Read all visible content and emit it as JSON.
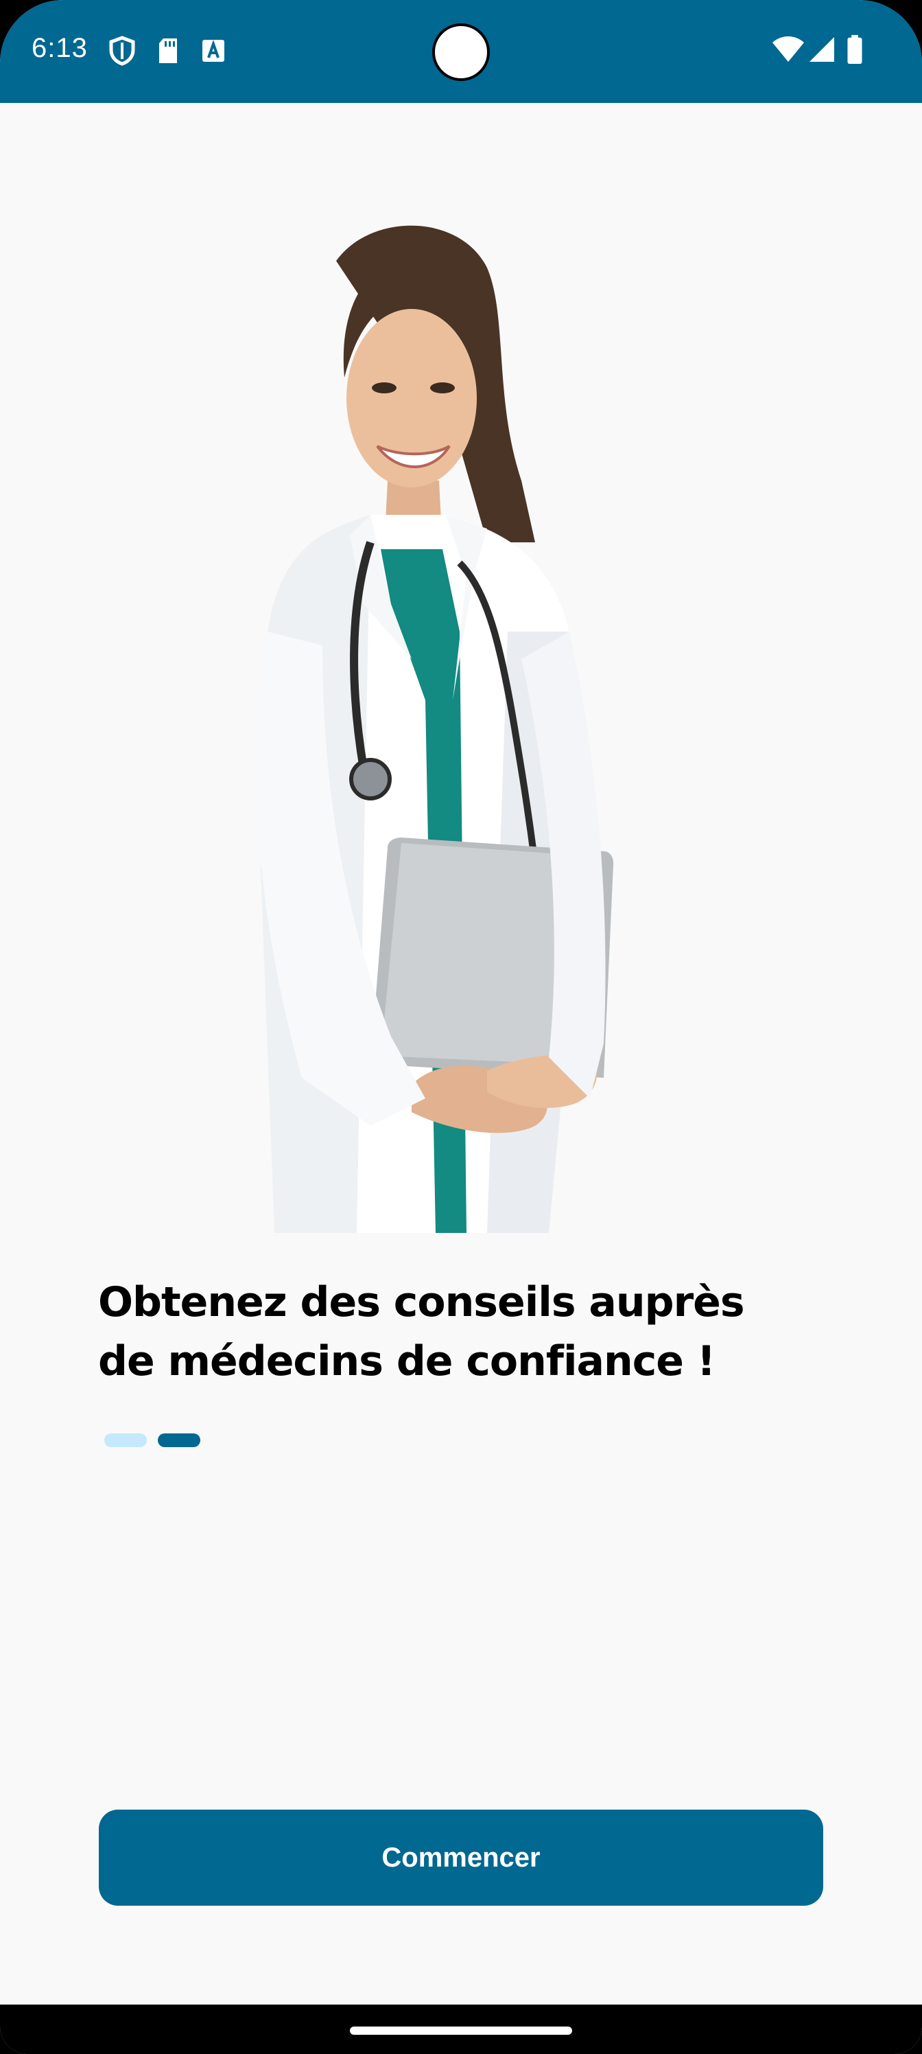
{
  "status_bar": {
    "time": "6:13",
    "left_icons": [
      "shield-icon",
      "sd-card-icon",
      "text-a-icon"
    ],
    "right_icons": [
      "wifi-icon",
      "signal-icon",
      "battery-icon"
    ],
    "background": "#006891"
  },
  "onboarding": {
    "image": "doctor-illustration",
    "headline_line1": "Obtenez des conseils auprès",
    "headline_line2": "de médecins de confiance !",
    "pager": {
      "total": 2,
      "active_index": 1,
      "active_color": "#006891",
      "inactive_color": "#c5e9fb"
    },
    "button_label": "Commencer"
  },
  "colors": {
    "primary": "#006891",
    "background": "#f9f9f9"
  }
}
